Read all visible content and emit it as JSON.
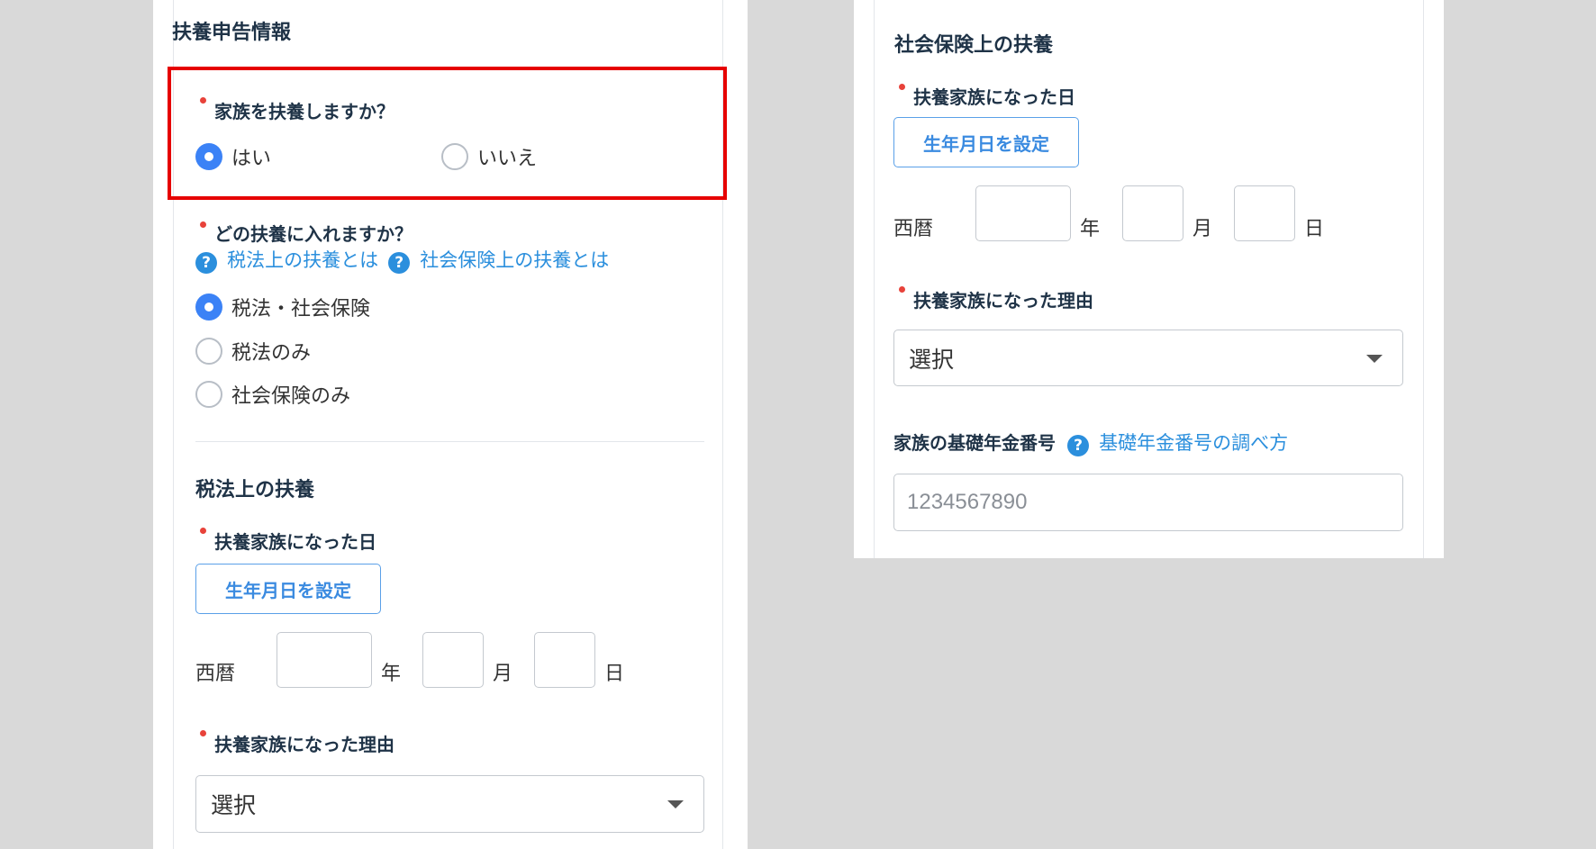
{
  "left": {
    "section_title": "扶養申告情報",
    "q_support": {
      "label": "家族を扶養しますか？",
      "options": [
        "はい",
        "いいえ"
      ],
      "selected": "はい"
    },
    "q_type": {
      "label": "どの扶養に入れますか？",
      "help_links": [
        "税法上の扶養とは",
        "社会保険上の扶養とは"
      ],
      "options": [
        "税法・社会保険",
        "税法のみ",
        "社会保険のみ"
      ],
      "selected": "税法・社会保険"
    },
    "tax": {
      "title": "税法上の扶養",
      "date_label": "扶養家族になった日",
      "birthday_button": "生年月日を設定",
      "era": "西暦",
      "year_unit": "年",
      "month_unit": "月",
      "day_unit": "日",
      "reason_label": "扶養家族になった理由",
      "reason_value": "選択"
    }
  },
  "right": {
    "title": "社会保険上の扶養",
    "date_label": "扶養家族になった日",
    "birthday_button": "生年月日を設定",
    "era": "西暦",
    "year_unit": "年",
    "month_unit": "月",
    "day_unit": "日",
    "reason_label": "扶養家族になった理由",
    "reason_value": "選択",
    "pension_label": "家族の基礎年金番号",
    "pension_help_link": "基礎年金番号の調べ方",
    "pension_placeholder": "1234567890"
  },
  "icons": {
    "help": "question-circle-icon",
    "dropdown": "caret-down-icon"
  },
  "colors": {
    "accent": "#3b82f6",
    "link": "#2b8fdd",
    "required": "#e8423a",
    "highlight": "#e60000"
  }
}
